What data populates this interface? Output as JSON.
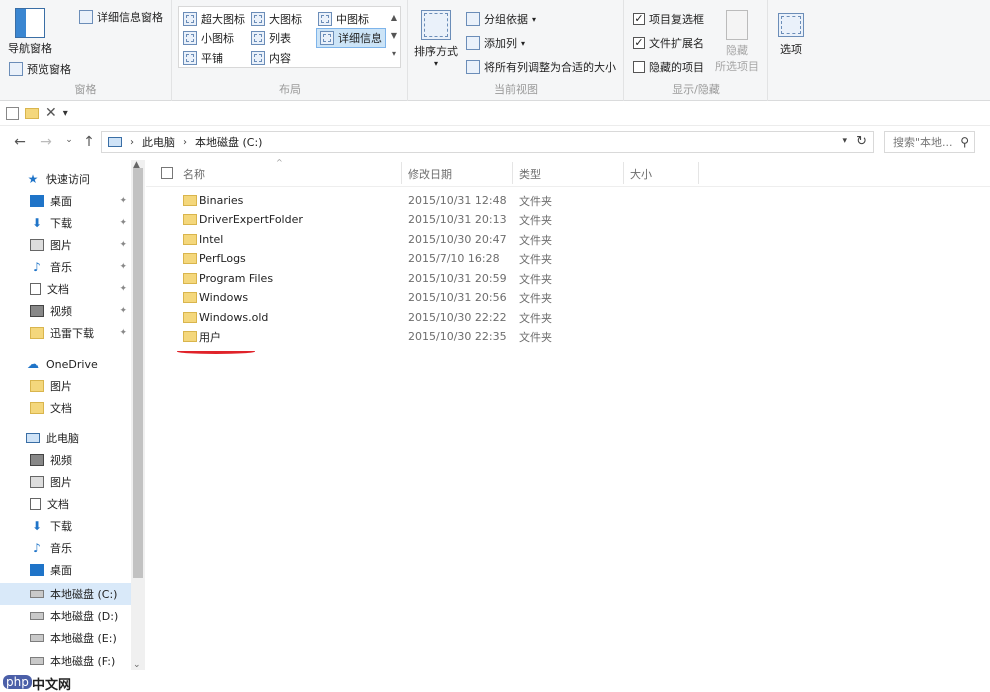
{
  "ribbon": {
    "panes": {
      "label": "窗格",
      "nav_pane": "导航窗格",
      "preview_pane": "预览窗格",
      "details_pane": "详细信息窗格"
    },
    "layout": {
      "label": "布局",
      "items": [
        "超大图标",
        "大图标",
        "中图标",
        "小图标",
        "列表",
        "详细信息",
        "平铺",
        "内容"
      ],
      "selected": "详细信息"
    },
    "current_view": {
      "label": "当前视图",
      "sort_by": "排序方式",
      "group_by": "分组依据",
      "add_columns": "添加列",
      "fit_columns": "将所有列调整为合适的大小"
    },
    "show_hide": {
      "label": "显示/隐藏",
      "item_checkboxes": "项目复选框",
      "file_extensions": "文件扩展名",
      "hidden_items": "隐藏的项目",
      "hide_selected_1": "隐藏",
      "hide_selected_2": "所选项目"
    },
    "options": "选项"
  },
  "address": {
    "crumbs": [
      "此电脑",
      "本地磁盘 (C:)"
    ],
    "search_placeholder": "搜索\"本地..."
  },
  "nav": {
    "quick_access": "快速访问",
    "quick_items": [
      "桌面",
      "下载",
      "图片",
      "音乐",
      "文档",
      "视频",
      "迅雷下载"
    ],
    "onedrive": "OneDrive",
    "onedrive_items": [
      "图片",
      "文档"
    ],
    "this_pc": "此电脑",
    "pc_items": [
      "视频",
      "图片",
      "文档",
      "下载",
      "音乐",
      "桌面",
      "本地磁盘 (C:)",
      "本地磁盘 (D:)",
      "本地磁盘 (E:)",
      "本地磁盘 (F:)"
    ],
    "selected": "本地磁盘 (C:)"
  },
  "columns": {
    "name": "名称",
    "modified": "修改日期",
    "type": "类型",
    "size": "大小"
  },
  "files": [
    {
      "name": "Binaries",
      "date": "2015/10/31 12:48",
      "type": "文件夹"
    },
    {
      "name": "DriverExpertFolder",
      "date": "2015/10/31 20:13",
      "type": "文件夹"
    },
    {
      "name": "Intel",
      "date": "2015/10/30 20:47",
      "type": "文件夹"
    },
    {
      "name": "PerfLogs",
      "date": "2015/7/10 16:28",
      "type": "文件夹"
    },
    {
      "name": "Program Files",
      "date": "2015/10/31 20:59",
      "type": "文件夹"
    },
    {
      "name": "Windows",
      "date": "2015/10/31 20:56",
      "type": "文件夹"
    },
    {
      "name": "Windows.old",
      "date": "2015/10/30 22:22",
      "type": "文件夹"
    },
    {
      "name": "用户",
      "date": "2015/10/30 22:35",
      "type": "文件夹"
    }
  ],
  "watermark": {
    "php": "php",
    "cn": "中文网"
  },
  "colors": {
    "accent": "#1f74c8",
    "folder": "#f4d77c",
    "highlight_line": "#e0232a",
    "selection": "#d9e9f9"
  }
}
